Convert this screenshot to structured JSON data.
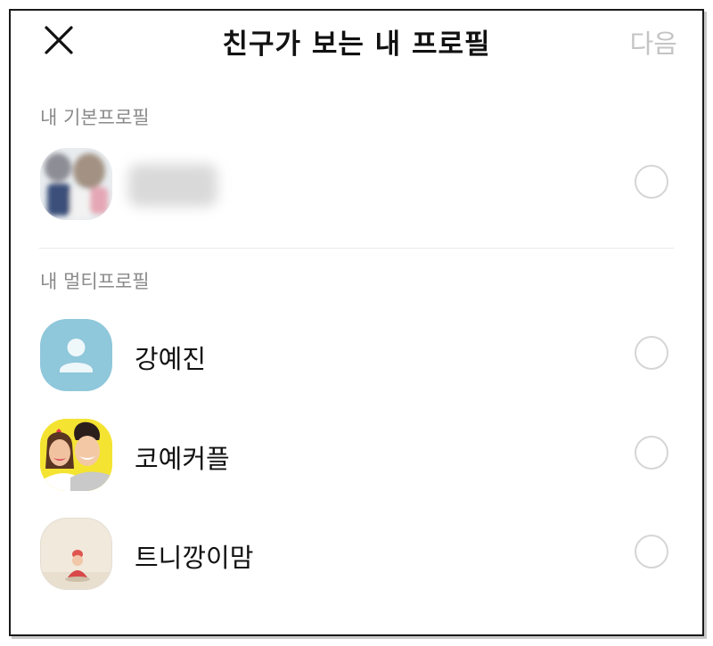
{
  "header": {
    "close_icon": "close-icon",
    "title": "친구가 보는 내 프로필",
    "next_label": "다음"
  },
  "basic_section": {
    "label": "내 기본프로필"
  },
  "multi_section": {
    "label": "내 멀티프로필",
    "profiles": [
      {
        "name": "강예진",
        "avatar": "default-person-icon",
        "avatar_color": "#8fc7db"
      },
      {
        "name": "코예커플",
        "avatar": "couple-illustration",
        "avatar_color": "#f4e431"
      },
      {
        "name": "트니깡이맘",
        "avatar": "baby-photo",
        "avatar_color": "#efe6d6"
      }
    ]
  },
  "colors": {
    "title_text": "#111111",
    "disabled_text": "#c4c4c4",
    "section_label": "#8a8a8a",
    "radio_border": "#d5d5d5"
  }
}
